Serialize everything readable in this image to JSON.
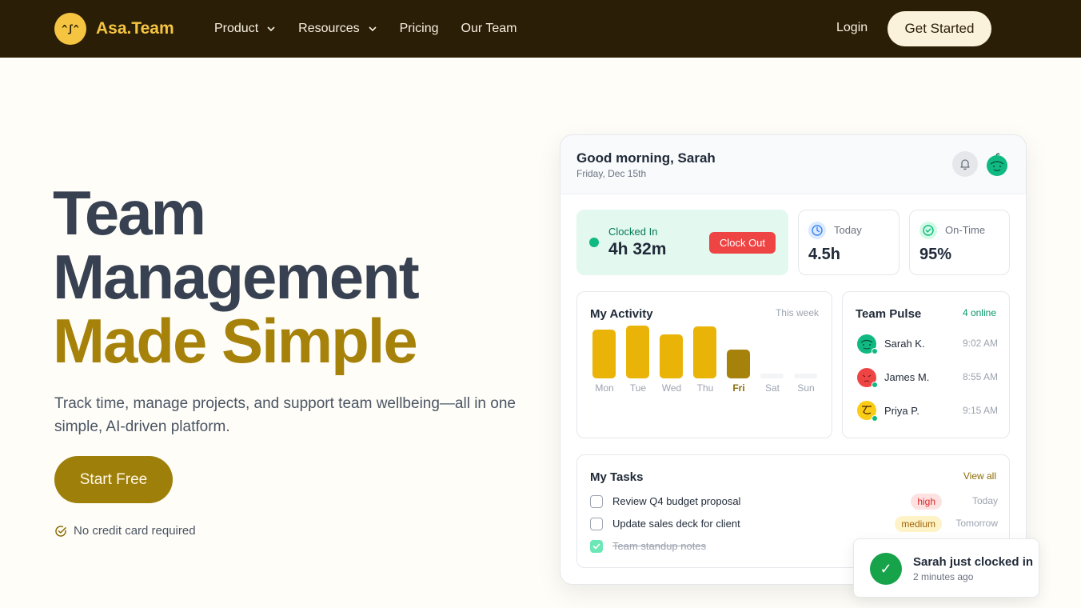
{
  "nav": {
    "brand": "Asa.Team",
    "logo_face": "^ʃ^",
    "links": [
      {
        "label": "Product",
        "has_dropdown": true
      },
      {
        "label": "Resources",
        "has_dropdown": true
      },
      {
        "label": "Pricing",
        "has_dropdown": false
      },
      {
        "label": "Our Team",
        "has_dropdown": false
      }
    ],
    "login": "Login",
    "get_started": "Get Started"
  },
  "hero": {
    "line1": "Team",
    "line2": "Management",
    "line3": "Made Simple",
    "subtitle": "Track time, manage projects, and support team wellbeing—all in one simple, AI-driven platform.",
    "cta": "Start Free",
    "note": "No credit card required"
  },
  "dashboard": {
    "greeting": "Good morning, Sarah",
    "date": "Friday, Dec 15th",
    "clock": {
      "label": "Clocked In",
      "time": "4h 32m",
      "button": "Clock Out"
    },
    "today": {
      "label": "Today",
      "value": "4.5h"
    },
    "ontime": {
      "label": "On-Time",
      "value": "95%"
    },
    "activity": {
      "title": "My Activity",
      "period": "This week",
      "days": [
        {
          "label": "Mon",
          "level": 0.92,
          "current": false
        },
        {
          "label": "Tue",
          "level": 1.0,
          "current": false
        },
        {
          "label": "Wed",
          "level": 0.83,
          "current": false
        },
        {
          "label": "Thu",
          "level": 0.98,
          "current": false
        },
        {
          "label": "Fri",
          "level": 0.55,
          "current": true
        },
        {
          "label": "Sat",
          "level": 0.0,
          "current": false
        },
        {
          "label": "Sun",
          "level": 0.0,
          "current": false
        }
      ]
    },
    "pulse": {
      "title": "Team Pulse",
      "online": "4 online",
      "members": [
        {
          "name": "Sarah K.",
          "time": "9:02 AM",
          "color": "#10b981"
        },
        {
          "name": "James M.",
          "time": "8:55 AM",
          "color": "#ef4444"
        },
        {
          "name": "Priya P.",
          "time": "9:15 AM",
          "color": "#facc15"
        }
      ]
    },
    "tasks": {
      "title": "My Tasks",
      "view_all": "View all",
      "items": [
        {
          "text": "Review Q4 budget proposal",
          "priority": "high",
          "due": "Today",
          "done": false
        },
        {
          "text": "Update sales deck for client",
          "priority": "medium",
          "due": "Tomorrow",
          "done": false
        },
        {
          "text": "Team standup notes",
          "priority": "",
          "due": "",
          "done": true
        }
      ]
    }
  },
  "toast": {
    "title": "Sarah just clocked in",
    "subtitle": "2 minutes ago",
    "icon": "✓"
  },
  "colors": {
    "nav_bg": "#2a1e06",
    "brand_yellow": "#f5c542",
    "accent_gold": "#a6820a",
    "green": "#10b981",
    "red": "#ef4444"
  }
}
